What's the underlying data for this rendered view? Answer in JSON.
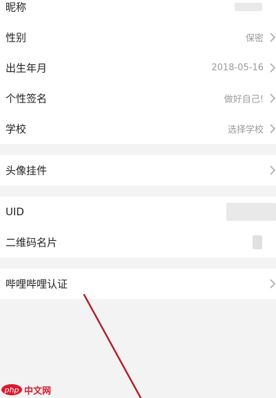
{
  "profile_section": {
    "nickname_label": "昵称",
    "gender_label": "性别",
    "gender_value": "保密",
    "birthday_label": "出生年月",
    "birthday_value": "2018-05-16",
    "signature_label": "个性签名",
    "signature_value": "做好自己!",
    "school_label": "学校",
    "school_value": "选择学校"
  },
  "pendant_section": {
    "pendant_label": "头像挂件"
  },
  "id_section": {
    "uid_label": "UID",
    "qrcode_label": "二维码名片"
  },
  "verify_section": {
    "verify_label": "哔哩哔哩认证"
  },
  "watermark": {
    "logo_text": "php",
    "site_text": "中文网"
  },
  "colors": {
    "annotation_line": "#b0202a",
    "watermark": "#d8192f"
  }
}
